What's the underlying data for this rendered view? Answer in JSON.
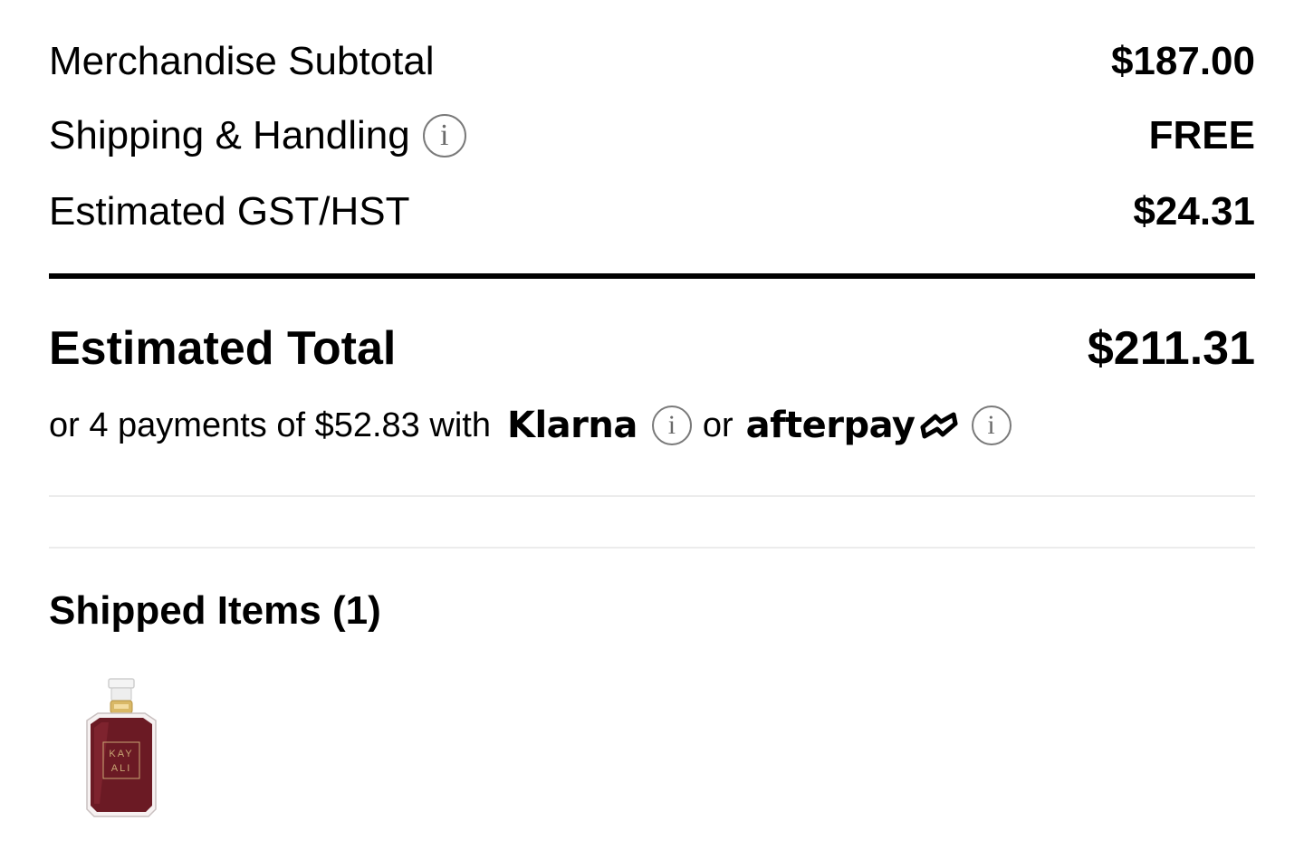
{
  "summary": {
    "subtotal": {
      "label": "Merchandise Subtotal",
      "value": "$187.00"
    },
    "shipping": {
      "label": "Shipping & Handling",
      "value": "FREE",
      "info_icon": "info-icon"
    },
    "tax": {
      "label": "Estimated GST/HST",
      "value": "$24.31"
    }
  },
  "total": {
    "label": "Estimated Total",
    "value": "$211.31"
  },
  "installments": {
    "prefix": "or 4 payments of $52.83 with",
    "klarna": "Klarna",
    "or": "or",
    "afterpay": "afterpay"
  },
  "shipped": {
    "title": "Shipped Items (1)",
    "items": [
      {
        "brand_text_line1": "KAY",
        "brand_text_line2": "ALI"
      }
    ]
  },
  "colors": {
    "text": "#000000",
    "divider": "#ececec",
    "info_icon": "#7a7a7a",
    "bottle": "#6b1a24"
  }
}
